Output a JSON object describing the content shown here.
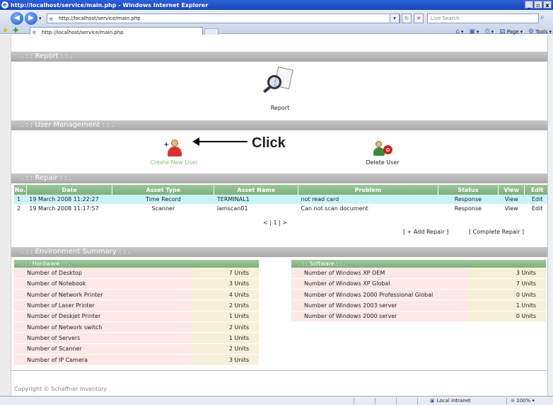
{
  "window": {
    "title": "http://localhost/service/main.php - Windows Internet Explorer",
    "min": "_",
    "max": "▫",
    "close": "x"
  },
  "address": {
    "url": "http://localhost/service/main.php",
    "search_placeholder": "Live Search"
  },
  "tab": {
    "label": "http://localhost/service/main.php"
  },
  "commands": {
    "page": "Page",
    "tools": "Tools"
  },
  "sections": {
    "report": ". : : Report : : .",
    "user_mgmt": ". : : User Management : : .",
    "repair": ". : : Repair : : .",
    "env": ". : : Environment Summary : : ."
  },
  "report": {
    "label": "Report"
  },
  "users": {
    "create_label": "Create New User",
    "delete_label": "Delete User",
    "annotation": "Click"
  },
  "repair": {
    "columns": [
      "No.",
      "Date",
      "Asset Type",
      "Asset Name",
      "Problem",
      "Status",
      "View",
      "Edit"
    ],
    "rows": [
      {
        "no": "1",
        "date": "19 March 2008 11:22:27",
        "type": "Time Record",
        "name": "TERMINAL1",
        "problem": "not read card",
        "status": "Response",
        "view": "View",
        "edit": "Edit"
      },
      {
        "no": "2",
        "date": "19 March 2008 11:17:57",
        "type": "Scanner",
        "name": "lamscan01",
        "problem": "Can not scan document",
        "status": "Response",
        "view": "View",
        "edit": "Edit"
      }
    ],
    "pager": "< | 1 | >",
    "add": "[ + Add Repair ]",
    "complete": "[ Complete Repair ]"
  },
  "hardware": {
    "header": ". : : Hardware : : .",
    "rows": [
      {
        "label": "Number of Desktop",
        "value": "7 Units"
      },
      {
        "label": "Number of Notebook",
        "value": "3 Units"
      },
      {
        "label": "Number of Network Printer",
        "value": "4 Units"
      },
      {
        "label": "Number of Laser Printer",
        "value": "2 Units"
      },
      {
        "label": "Number of Deskjet Printer",
        "value": "1 Units"
      },
      {
        "label": "Number of Network switch",
        "value": "2 Units"
      },
      {
        "label": "Number of Servers",
        "value": "1 Units"
      },
      {
        "label": "Number of Scanner",
        "value": "2 Units"
      },
      {
        "label": "Number of IP Camera",
        "value": "3 Units"
      }
    ]
  },
  "software": {
    "header": ". : : Software : : .",
    "rows": [
      {
        "label": "Number of Windows XP OEM",
        "value": "3 Units"
      },
      {
        "label": "Number of Windows XP Global",
        "value": "7 Units"
      },
      {
        "label": "Number of Windows 2000 Professional Global",
        "value": "0 Units"
      },
      {
        "label": "Number of Windows 2003 server",
        "value": "1 Units"
      },
      {
        "label": "Number of Windows 2000 server",
        "value": "0 Units"
      }
    ]
  },
  "footer": {
    "copyright": "Copyright © Schaffner Inventory"
  },
  "status": {
    "zone": "Local intranet",
    "zoom": "100%"
  }
}
